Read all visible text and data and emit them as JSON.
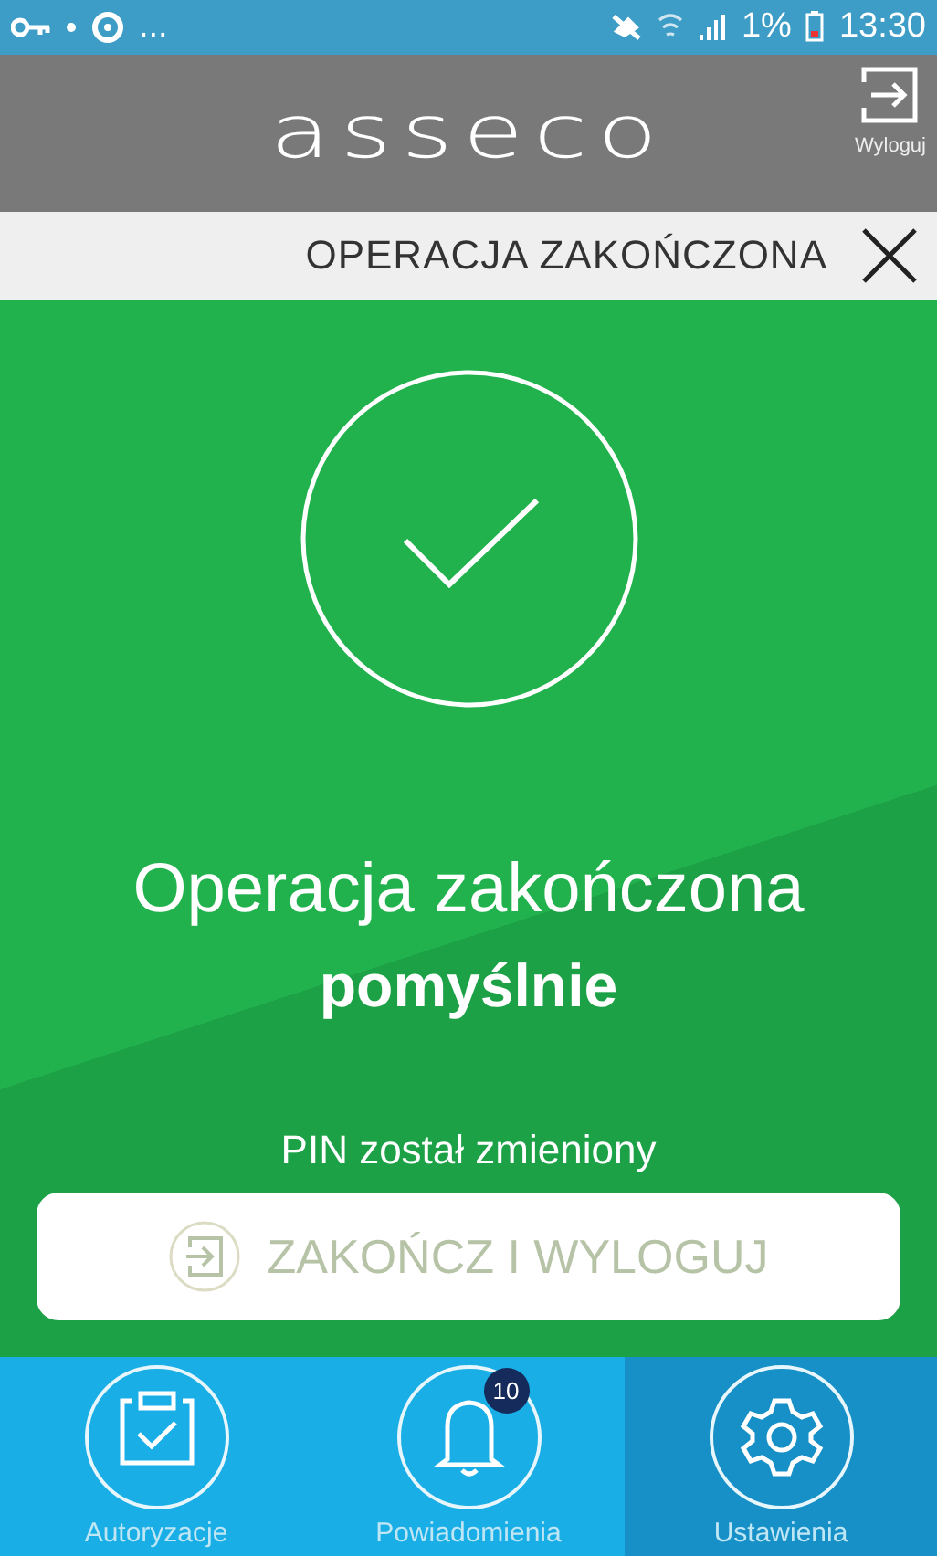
{
  "status_bar": {
    "overflow": "...",
    "battery": "1%",
    "time": "13:30"
  },
  "header": {
    "logo": "asseco",
    "logout_label": "Wyloguj"
  },
  "title_bar": {
    "title": "OPERACJA ZAKOŃCZONA"
  },
  "result": {
    "headline": "Operacja zakończona",
    "headline_bold": "pomyślnie",
    "message": "PIN został zmieniony",
    "button": "ZAKOŃCZ I WYLOGUJ"
  },
  "nav": [
    {
      "kind": "clipboard",
      "label": "Autoryzacje",
      "selected": false
    },
    {
      "kind": "bell",
      "label": "Powiadomienia",
      "badge": "10",
      "selected": false
    },
    {
      "kind": "gear",
      "label": "Ustawienia",
      "selected": true
    }
  ]
}
